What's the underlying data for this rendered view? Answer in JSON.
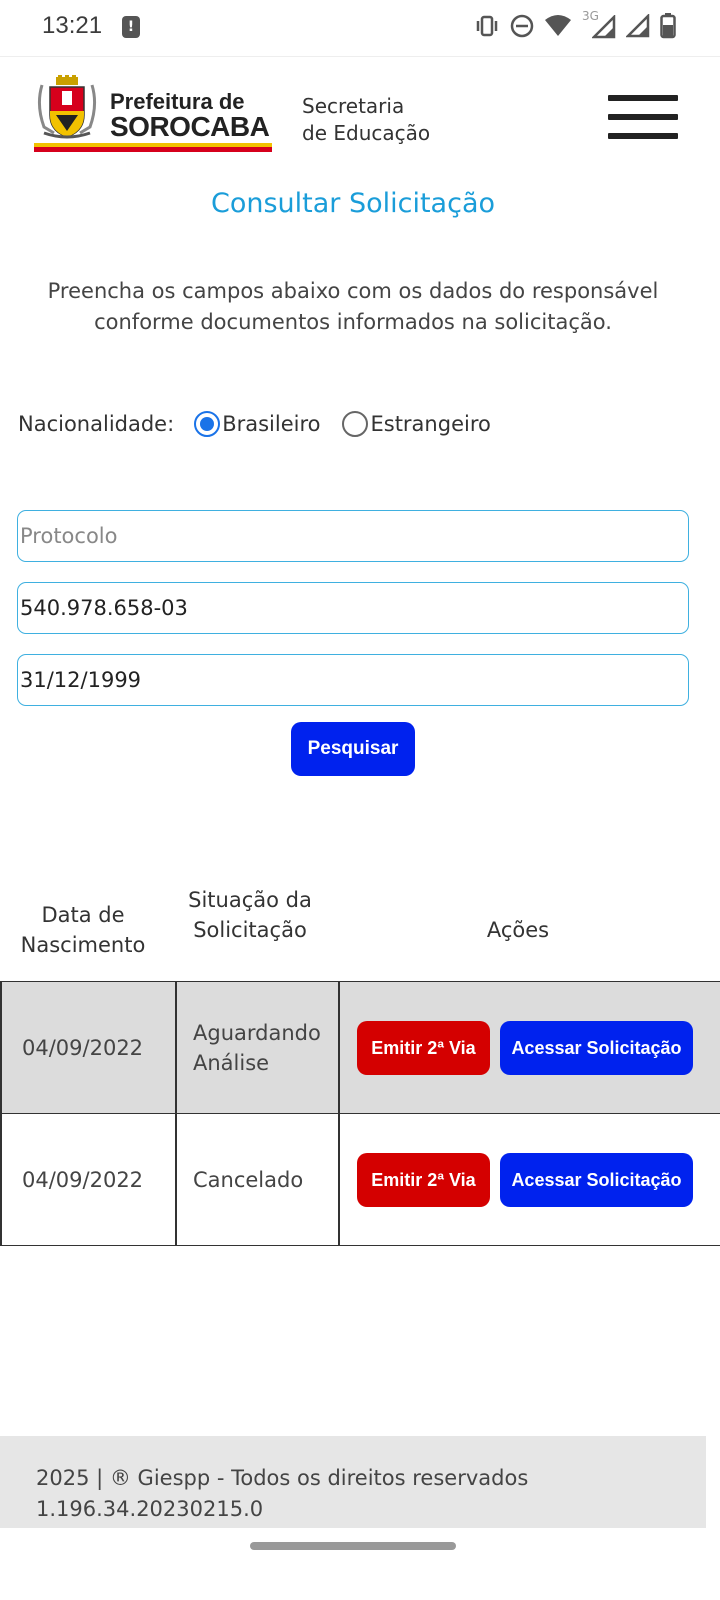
{
  "status_bar": {
    "time": "13:21",
    "network": "3G",
    "icons": [
      "vibrate-icon",
      "dnd-icon",
      "wifi-icon",
      "signal-icon",
      "signal-icon",
      "battery-icon"
    ]
  },
  "header": {
    "logo_line1": "Prefeitura de",
    "logo_line2": "SOROCABA",
    "secretaria_line1": "Secretaria",
    "secretaria_line2": "de Educação"
  },
  "page": {
    "title": "Consultar Solicitação",
    "intro": "Preencha os campos abaixo com os dados do responsável conforme documentos informados na solicitação."
  },
  "form": {
    "nationality_label": "Nacionalidade:",
    "options": [
      "Brasileiro",
      "Estrangeiro"
    ],
    "selected": "Brasileiro",
    "protocol_placeholder": "Protocolo",
    "protocol_value": "",
    "cpf_value": "540.978.658-03",
    "birth_value": "31/12/1999",
    "search_label": "Pesquisar"
  },
  "table": {
    "headers": {
      "birth": "Data de Nascimento",
      "status": "Situação da Solicitação",
      "actions": "Ações"
    },
    "rows": [
      {
        "birth": "04/09/2022",
        "status": "Aguardando Análise",
        "emit": "Emitir 2ª Via",
        "access": "Acessar Solicitação"
      },
      {
        "birth": "04/09/2022",
        "status": "Cancelado",
        "emit": "Emitir 2ª Via",
        "access": "Acessar Solicitação"
      }
    ]
  },
  "footer": {
    "copyright": "2025 | ® Giespp - Todos os direitos reservados",
    "version": "1.196.34.20230215.0"
  },
  "colors": {
    "title_blue": "#1a9dd9",
    "button_blue": "#0022ee",
    "button_red": "#d40000",
    "input_border": "#3fb0e0"
  }
}
